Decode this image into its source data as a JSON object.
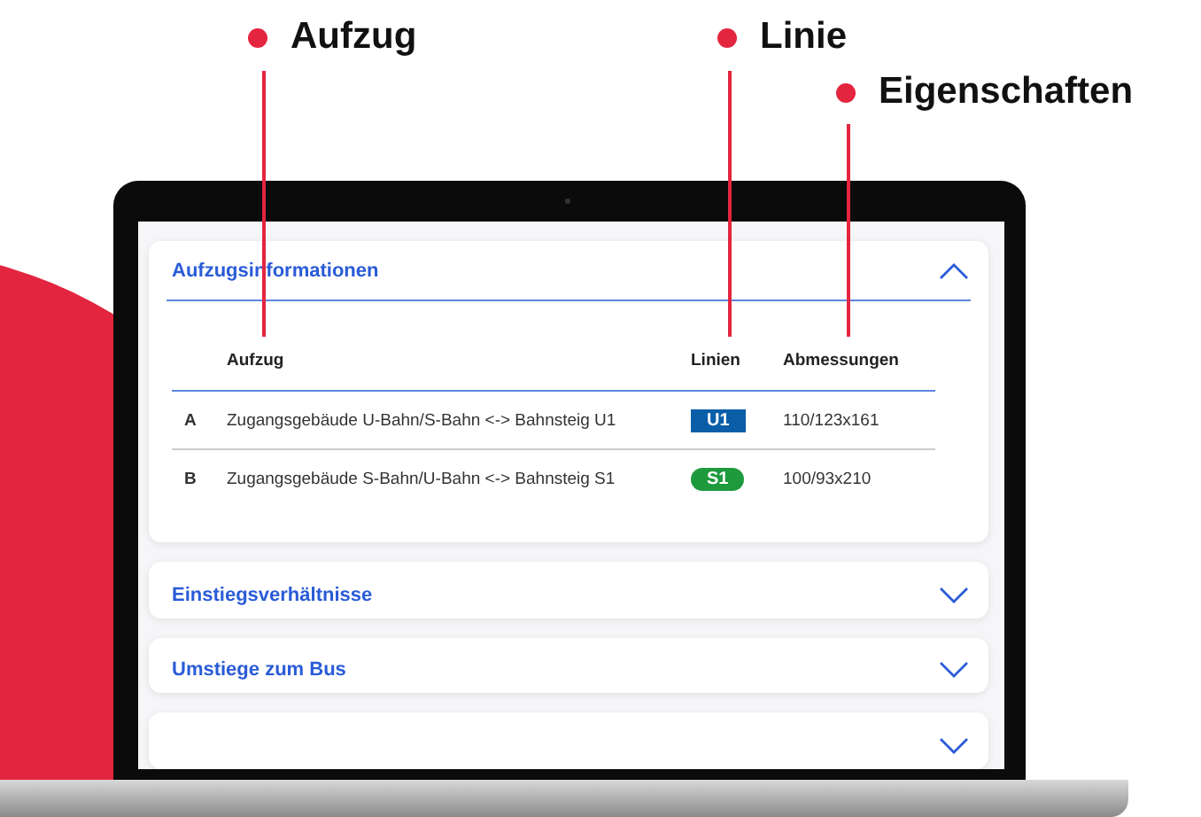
{
  "callouts": [
    {
      "label": "Aufzug"
    },
    {
      "label": "Linie"
    },
    {
      "label": "Eigenschaften"
    }
  ],
  "sections": [
    {
      "title": "Aufzugsinformationen",
      "expanded": true,
      "table": {
        "columns": [
          "Aufzug",
          "Linien",
          "Abmessungen"
        ],
        "rows": [
          {
            "letter": "A",
            "name": "Zugangsgebäude U-Bahn/S-Bahn <-> Bahnsteig U1",
            "line": {
              "label": "U1",
              "kind": "ubahn",
              "color": "#0a5ea8"
            },
            "dimensions": "110/123x161"
          },
          {
            "letter": "B",
            "name": "Zugangsgebäude S-Bahn/U-Bahn <-> Bahnsteig S1",
            "line": {
              "label": "S1",
              "kind": "sbahn",
              "color": "#1e9a3c"
            },
            "dimensions": "100/93x210"
          }
        ]
      }
    },
    {
      "title": "Einstiegsverhältnisse",
      "expanded": false
    },
    {
      "title": "Umstiege zum Bus",
      "expanded": false
    },
    {
      "expanded": false
    }
  ]
}
